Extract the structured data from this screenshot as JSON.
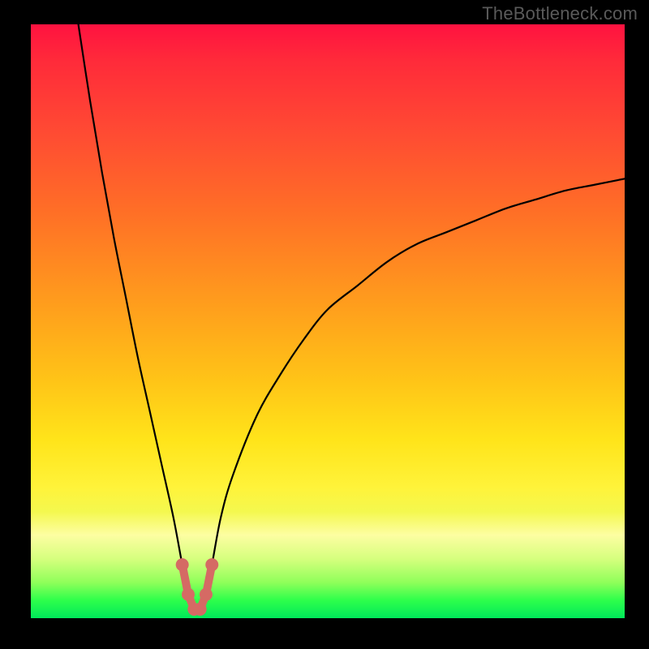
{
  "watermark": "TheBottleneck.com",
  "chart_data": {
    "type": "line",
    "title": "",
    "xlabel": "",
    "ylabel": "",
    "xlim": [
      0,
      100
    ],
    "ylim": [
      0,
      100
    ],
    "grid": false,
    "legend": null,
    "description": "Asymmetric V-shaped bottleneck curve over a vertical red→green heat gradient. The minimum sits near x≈28 at y≈0. Left branch rises to y=100 at x≈8. Right branch rises asymptotically, reaching y≈74 at x=100.",
    "series": [
      {
        "name": "bottleneck-curve",
        "color": "#000000",
        "x": [
          8,
          10,
          12,
          14,
          16,
          18,
          20,
          22,
          24,
          25.5,
          26.5,
          27.5,
          28.5,
          29.5,
          30.5,
          32,
          34,
          38,
          42,
          46,
          50,
          55,
          60,
          65,
          70,
          75,
          80,
          85,
          90,
          95,
          100
        ],
        "y": [
          100,
          87,
          75,
          64,
          54,
          44,
          35,
          26,
          17,
          9,
          4,
          1.5,
          1.5,
          4,
          9,
          17,
          24,
          34,
          41,
          47,
          52,
          56,
          60,
          63,
          65,
          67,
          69,
          70.5,
          72,
          73,
          74
        ]
      },
      {
        "name": "trough-markers",
        "color": "#d56a64",
        "x": [
          25.5,
          26.5,
          27.5,
          28.5,
          29.5,
          30.5
        ],
        "y": [
          9,
          4,
          1.5,
          1.5,
          4,
          9
        ]
      }
    ],
    "background_gradient_stops": [
      {
        "pos": 0,
        "color": "#ff1240"
      },
      {
        "pos": 18,
        "color": "#ff4a33"
      },
      {
        "pos": 48,
        "color": "#ffa01c"
      },
      {
        "pos": 70,
        "color": "#ffe41a"
      },
      {
        "pos": 86,
        "color": "#fdfea2"
      },
      {
        "pos": 94,
        "color": "#8fff5a"
      },
      {
        "pos": 100,
        "color": "#00e85a"
      }
    ]
  }
}
